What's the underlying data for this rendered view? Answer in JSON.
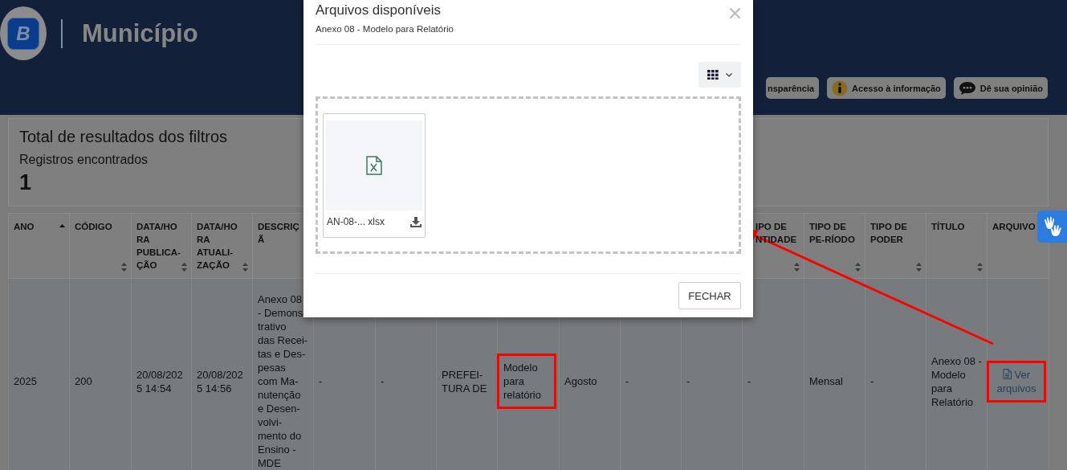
{
  "header": {
    "logo_letter": "B",
    "title": "Município",
    "buttons": [
      {
        "label": "nsparência",
        "kind": "plain"
      },
      {
        "label": "Acesso à informação",
        "kind": "info"
      },
      {
        "label": "Dê sua opinião",
        "kind": "chat"
      }
    ]
  },
  "results": {
    "title": "Total de resultados dos filtros",
    "label": "Registros encontrados",
    "count": "1"
  },
  "table": {
    "columns": [
      {
        "label": "ANO",
        "sortable": true,
        "sorted_ascending": true
      },
      {
        "label": "CÓDIGO",
        "sortable": true,
        "sorted_ascending": false
      },
      {
        "label": "DATA/HORA PUBLICA-ÇÃO",
        "sortable": true,
        "sorted_ascending": false
      },
      {
        "label": "DATA/HORA ATUALI-ZAÇÃO",
        "sortable": true,
        "sorted_ascending": false
      },
      {
        "label": "DESCRIÇÃ",
        "sortable": false
      },
      {},
      {},
      {},
      {},
      {},
      {},
      {},
      {
        "label": "IPO DE NTIDADE",
        "sortable": true,
        "sorted_ascending": false
      },
      {
        "label": "TIPO DE PE-RÍODO",
        "sortable": true,
        "sorted_ascending": false
      },
      {
        "label": "TIPO DE PODER",
        "sortable": true,
        "sorted_ascending": false
      },
      {
        "label": "TÍTULO",
        "sortable": true,
        "sorted_ascending": false
      },
      {
        "label": "ARQUIVO",
        "sortable": false
      }
    ],
    "rows": [
      {
        "cells": [
          {
            "kind": "text",
            "text": "2025",
            "highlighted": false
          },
          {
            "kind": "text",
            "text": "200",
            "highlighted": false
          },
          {
            "kind": "lines",
            "lines": [
              "20/08/202",
              "5 14:54"
            ],
            "highlighted": false
          },
          {
            "kind": "lines",
            "lines": [
              "20/08/202",
              "5 14:56"
            ],
            "highlighted": false
          },
          {
            "kind": "lines",
            "lines": [
              "Anexo 08",
              "- Demons",
              "trativo",
              "das Recei-",
              "tas e Des-",
              "pesas",
              "com Ma-",
              "nutenção",
              "e Desen-",
              "volvi-",
              "mento do",
              "Ensino -",
              "MDE"
            ],
            "highlighted": false
          },
          {
            "kind": "text",
            "text": "-",
            "highlighted": false
          },
          {
            "kind": "text",
            "text": "-",
            "highlighted": false
          },
          {
            "kind": "lines",
            "lines": [
              "PREFEI-",
              "TURA DE"
            ],
            "highlighted": false
          },
          {
            "kind": "text",
            "text": "Modelo para relatório",
            "highlighted": true
          },
          {
            "kind": "text",
            "text": "Agosto",
            "highlighted": false
          },
          {
            "kind": "text",
            "text": "-",
            "highlighted": false
          },
          {
            "kind": "text",
            "text": "-",
            "highlighted": false
          },
          {
            "kind": "text",
            "text": "-",
            "highlighted": false
          },
          {
            "kind": "text",
            "text": "Mensal",
            "highlighted": false
          },
          {
            "kind": "text",
            "text": "-",
            "highlighted": false
          },
          {
            "kind": "text",
            "text": "Anexo 08 - Modelo para Relatório",
            "highlighted": false
          },
          {
            "kind": "link",
            "text": "Ver arquivos",
            "highlighted": true
          }
        ]
      }
    ]
  },
  "modal": {
    "title": "Arquivos disponíveis",
    "subtitle": "Anexo 08 - Modelo para Relatório",
    "files": [
      {
        "name": "AN-08-... xlsx",
        "kind": "spreadsheet"
      }
    ],
    "close_button": "FECHAR"
  }
}
